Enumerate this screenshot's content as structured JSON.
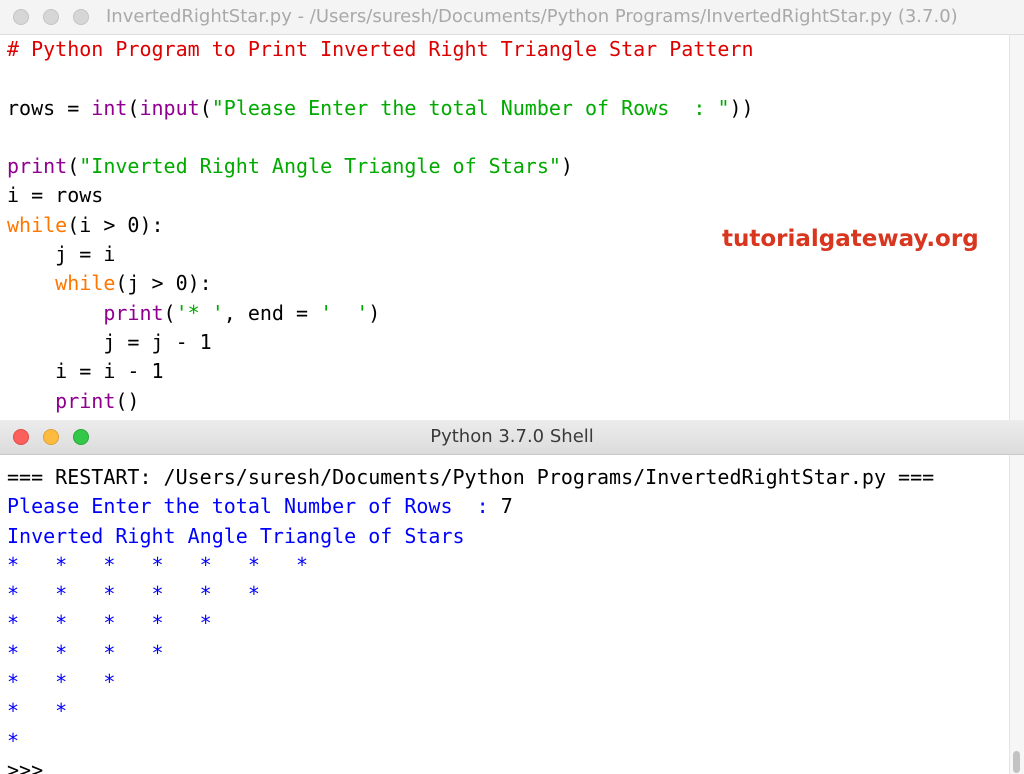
{
  "editor": {
    "title": "InvertedRightStar.py - /Users/suresh/Documents/Python Programs/InvertedRightStar.py (3.7.0)",
    "code": [
      [
        [
          "comment",
          "# Python Program to Print Inverted Right Triangle Star Pattern"
        ]
      ],
      [
        [
          "plain",
          ""
        ]
      ],
      [
        [
          "plain",
          "rows = "
        ],
        [
          "builtin",
          "int"
        ],
        [
          "plain",
          "("
        ],
        [
          "builtin",
          "input"
        ],
        [
          "plain",
          "("
        ],
        [
          "string",
          "\"Please Enter the total Number of Rows  : \""
        ],
        [
          "plain",
          "))"
        ]
      ],
      [
        [
          "plain",
          ""
        ]
      ],
      [
        [
          "builtin",
          "print"
        ],
        [
          "plain",
          "("
        ],
        [
          "string",
          "\"Inverted Right Angle Triangle of Stars\""
        ],
        [
          "plain",
          ")"
        ]
      ],
      [
        [
          "plain",
          "i = rows"
        ]
      ],
      [
        [
          "keyword",
          "while"
        ],
        [
          "plain",
          "(i > 0):"
        ]
      ],
      [
        [
          "plain",
          "    j = i"
        ]
      ],
      [
        [
          "plain",
          "    "
        ],
        [
          "keyword",
          "while"
        ],
        [
          "plain",
          "(j > 0):"
        ]
      ],
      [
        [
          "plain",
          "        "
        ],
        [
          "builtin",
          "print"
        ],
        [
          "plain",
          "("
        ],
        [
          "string",
          "'* '"
        ],
        [
          "plain",
          ", end = "
        ],
        [
          "string",
          "'  '"
        ],
        [
          "plain",
          ")"
        ]
      ],
      [
        [
          "plain",
          "        j = j - 1"
        ]
      ],
      [
        [
          "plain",
          "    i = i - 1"
        ]
      ],
      [
        [
          "plain",
          "    "
        ],
        [
          "builtin",
          "print"
        ],
        [
          "plain",
          "()"
        ]
      ]
    ]
  },
  "watermark": "tutorialgateway.org",
  "shell": {
    "title": "Python 3.7.0 Shell",
    "output": [
      [
        [
          "plain",
          "=== RESTART: /Users/suresh/Documents/Python Programs/InvertedRightStar.py ==="
        ]
      ],
      [
        [
          "stdout",
          "Please Enter the total Number of Rows  : "
        ],
        [
          "plain",
          "7"
        ]
      ],
      [
        [
          "stdout",
          "Inverted Right Angle Triangle of Stars"
        ]
      ],
      [
        [
          "stdout",
          "*   *   *   *   *   *   *"
        ]
      ],
      [
        [
          "stdout",
          "*   *   *   *   *   *"
        ]
      ],
      [
        [
          "stdout",
          "*   *   *   *   *"
        ]
      ],
      [
        [
          "stdout",
          "*   *   *   *"
        ]
      ],
      [
        [
          "stdout",
          "*   *   *"
        ]
      ],
      [
        [
          "stdout",
          "*   *"
        ]
      ],
      [
        [
          "stdout",
          "*"
        ]
      ],
      [
        [
          "plain",
          ">>> "
        ]
      ]
    ]
  },
  "colors": {
    "comment": "#dd0000",
    "keyword": "#ff7700",
    "builtin": "#900090",
    "string": "#00aa00",
    "stdout": "#0000ff",
    "watermark": "#d9361f"
  }
}
